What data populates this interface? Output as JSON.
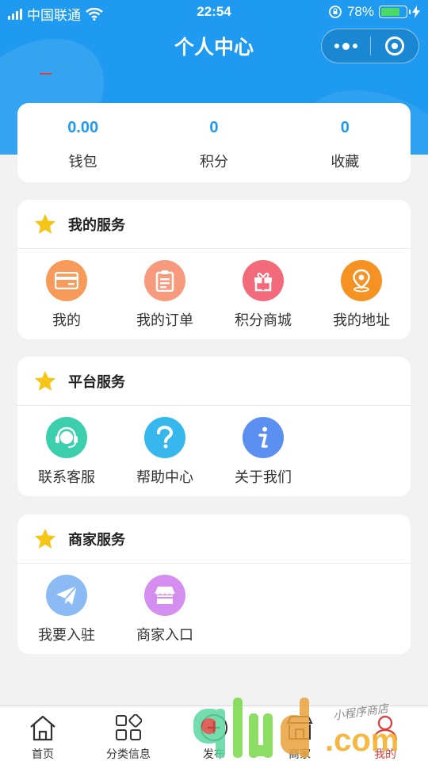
{
  "status_bar": {
    "carrier": "中国联通",
    "time": "22:54",
    "battery_percent": "78%",
    "battery_level": 0.78
  },
  "nav": {
    "title": "个人中心"
  },
  "stats": [
    {
      "value": "0.00",
      "label": "钱包"
    },
    {
      "value": "0",
      "label": "积分"
    },
    {
      "value": "0",
      "label": "收藏"
    }
  ],
  "sections": {
    "my_services": {
      "title": "我的服务",
      "items": [
        {
          "label": "我的",
          "icon": "card-icon",
          "color": "#f79a5a"
        },
        {
          "label": "我的订单",
          "icon": "clipboard-icon",
          "color": "#f79a7e"
        },
        {
          "label": "积分商城",
          "icon": "gift-icon",
          "color": "#f36a7a"
        },
        {
          "label": "我的地址",
          "icon": "location-pin-icon",
          "color": "#f59223"
        }
      ]
    },
    "platform_services": {
      "title": "平台服务",
      "items": [
        {
          "label": "联系客服",
          "icon": "headset-icon",
          "color": "#3ccfae"
        },
        {
          "label": "帮助中心",
          "icon": "question-icon",
          "color": "#36b7ee"
        },
        {
          "label": "关于我们",
          "icon": "info-icon",
          "color": "#5b8ff0"
        }
      ]
    },
    "merchant_services": {
      "title": "商家服务",
      "items": [
        {
          "label": "我要入驻",
          "icon": "paper-plane-icon",
          "color": "#8cbaf5"
        },
        {
          "label": "商家入口",
          "icon": "shop-icon",
          "color": "#d38ef0"
        }
      ]
    }
  },
  "tabbar": [
    {
      "label": "首页",
      "icon": "home-icon"
    },
    {
      "label": "分类信息",
      "icon": "grid-icon"
    },
    {
      "label": "发布",
      "icon": "plus-circle-icon"
    },
    {
      "label": "商家",
      "icon": "store-icon"
    },
    {
      "label": "我的",
      "icon": "user-icon",
      "active": true
    }
  ],
  "watermark": {
    "brand": "9lud",
    "domain": ".com",
    "script": "小程序商店"
  },
  "colors": {
    "primary": "#1e9af0",
    "active_tab": "#e53935",
    "star": "#f5c518"
  }
}
